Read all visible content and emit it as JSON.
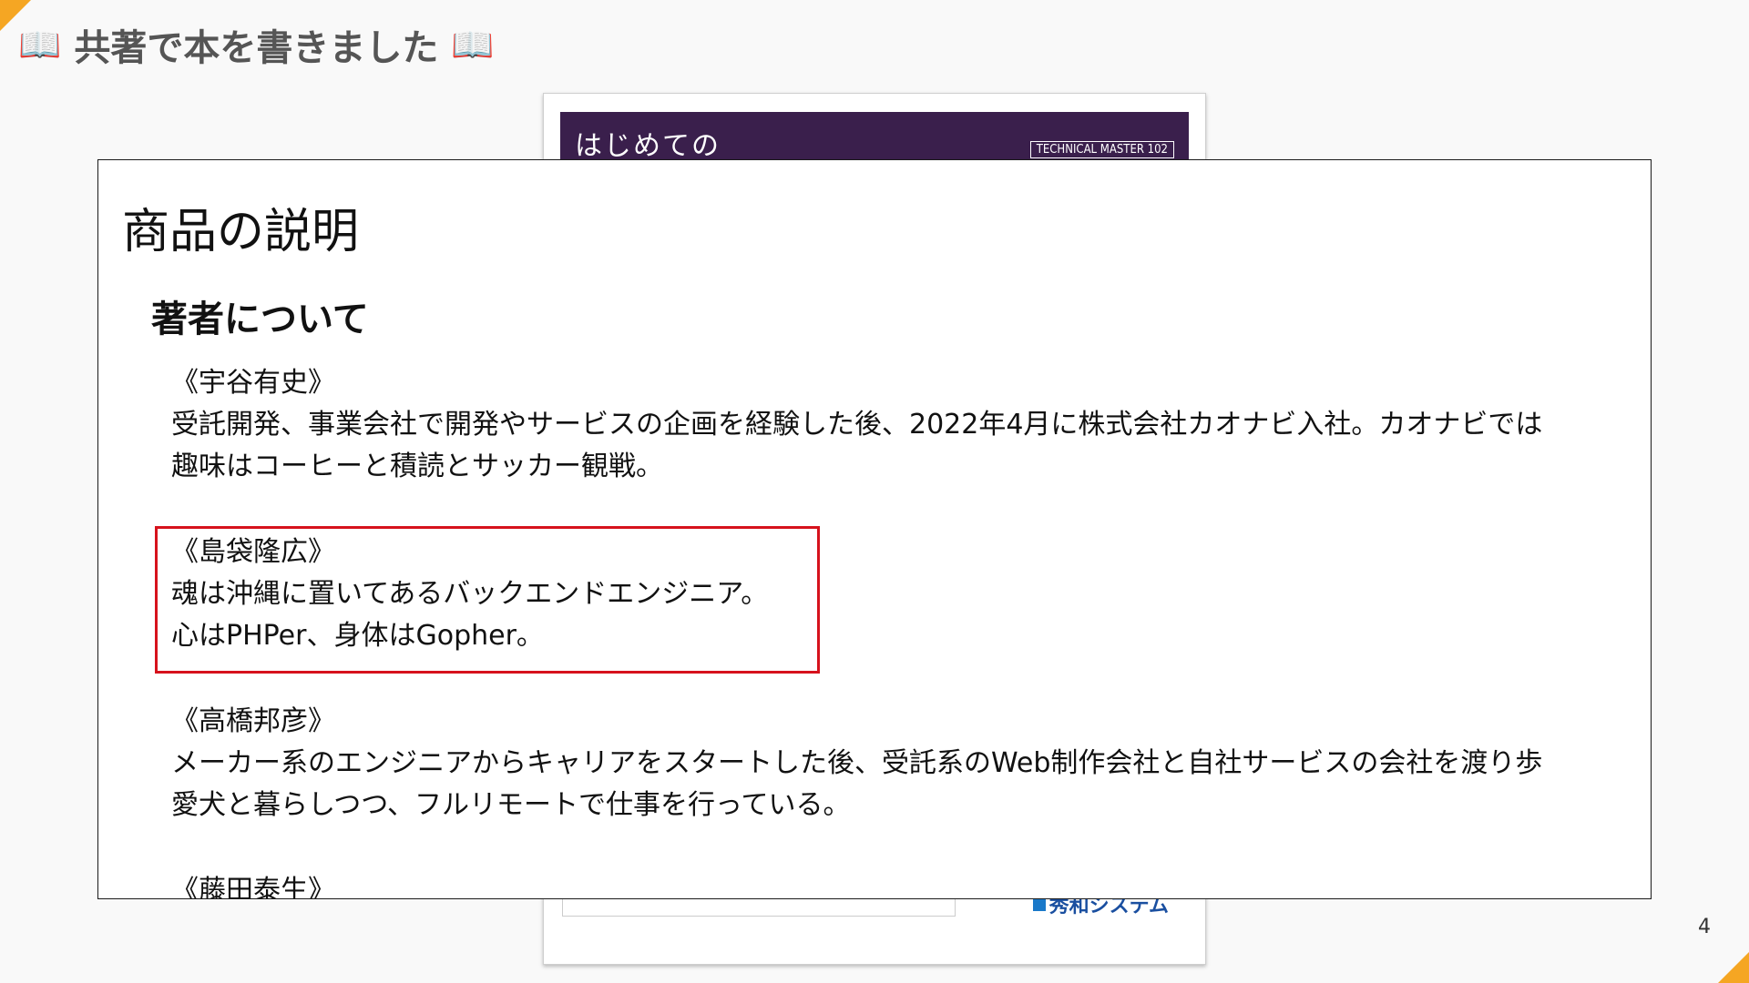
{
  "slide": {
    "title": "共著で本を書きました",
    "page_number": "4",
    "accent_color": "#f5a623",
    "icons": [
      "open-book-icon",
      "open-book-icon"
    ]
  },
  "book_cover": {
    "title_fragment": "はじめての",
    "series_badge": "TECHNICAL MASTER 102",
    "publisher": "秀和システム"
  },
  "description": {
    "heading": "商品の説明",
    "authors_heading": "著者について",
    "highlight_color": "#d6121c",
    "authors": [
      {
        "name": "《宇谷有史》",
        "lines": [
          "受託開発、事業会社で開発やサービスの企画を経験した後、2022年4月に株式会社カオナビ入社。カオナビでは",
          "趣味はコーヒーと積読とサッカー観戦。"
        ]
      },
      {
        "name": "《島袋隆広》",
        "lines": [
          "魂は沖縄に置いてあるバックエンドエンジニア。",
          "心はPHPer、身体はGopher。"
        ]
      },
      {
        "name": "《高橋邦彦》",
        "lines": [
          "メーカー系のエンジニアからキャリアをスタートした後、受託系のWeb制作会社と自社サービスの会社を渡り歩",
          "愛犬と暮らしつつ、フルリモートで仕事を行っている。"
        ]
      },
      {
        "name": "《藤田泰生》",
        "lines": []
      }
    ]
  }
}
